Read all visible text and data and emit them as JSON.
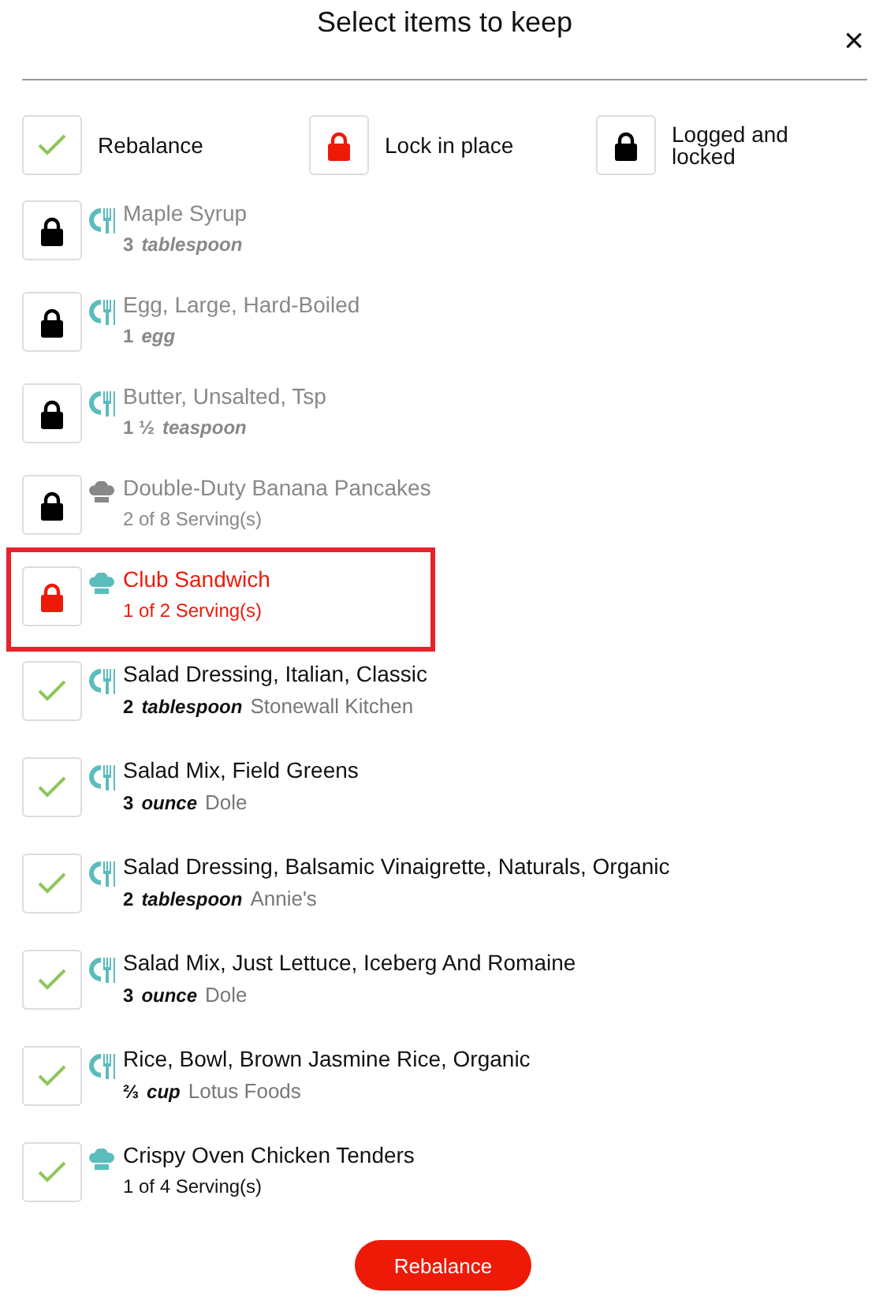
{
  "title": "Select items to keep",
  "close": "×",
  "legend": [
    {
      "kind": "rebalance",
      "label": "Rebalance"
    },
    {
      "kind": "lock",
      "label": "Lock in place"
    },
    {
      "kind": "logged",
      "label": "Logged and locked"
    }
  ],
  "items": [
    {
      "kind": "food",
      "locked": true,
      "logged": true,
      "selected": false,
      "name": "Maple Syrup",
      "amount": "3",
      "unit": "tablespoon"
    },
    {
      "kind": "food",
      "locked": true,
      "logged": true,
      "selected": false,
      "name": "Egg, Large, Hard-Boiled",
      "amount": "1",
      "unit": "egg"
    },
    {
      "kind": "food",
      "locked": true,
      "logged": true,
      "selected": false,
      "name": "Butter, Unsalted, Tsp",
      "amount": "1 ½",
      "unit": "teaspoon"
    },
    {
      "kind": "recipe",
      "locked": true,
      "logged": true,
      "selected": false,
      "name": "Double-Duty Banana Pancakes",
      "servings": "2 of 8 Serving(s)"
    },
    {
      "kind": "recipe",
      "locked": true,
      "logged": false,
      "selected": true,
      "name": "Club Sandwich",
      "servings": "1 of 2 Serving(s)"
    },
    {
      "kind": "food",
      "locked": false,
      "logged": false,
      "selected": false,
      "name": "Salad Dressing, Italian, Classic",
      "amount": "2",
      "unit": "tablespoon",
      "brand": "Stonewall Kitchen"
    },
    {
      "kind": "food",
      "locked": false,
      "logged": false,
      "selected": false,
      "name": "Salad Mix, Field Greens",
      "amount": "3",
      "unit": "ounce",
      "brand": "Dole"
    },
    {
      "kind": "food",
      "locked": false,
      "logged": false,
      "selected": false,
      "name": "Salad Dressing, Balsamic Vinaigrette, Naturals, Organic",
      "amount": "2",
      "unit": "tablespoon",
      "brand": "Annie's"
    },
    {
      "kind": "food",
      "locked": false,
      "logged": false,
      "selected": false,
      "name": "Salad Mix, Just Lettuce, Iceberg And Romaine",
      "amount": "3",
      "unit": "ounce",
      "brand": "Dole"
    },
    {
      "kind": "food",
      "locked": false,
      "logged": false,
      "selected": false,
      "name": "Rice, Bowl, Brown Jasmine Rice, Organic",
      "amount": "⅔",
      "unit": "cup",
      "brand": "Lotus Foods"
    },
    {
      "kind": "recipe",
      "locked": false,
      "logged": false,
      "selected": false,
      "name": "Crispy Oven Chicken Tenders",
      "servings": "1 of 4 Serving(s)"
    }
  ],
  "button": "Rebalance"
}
